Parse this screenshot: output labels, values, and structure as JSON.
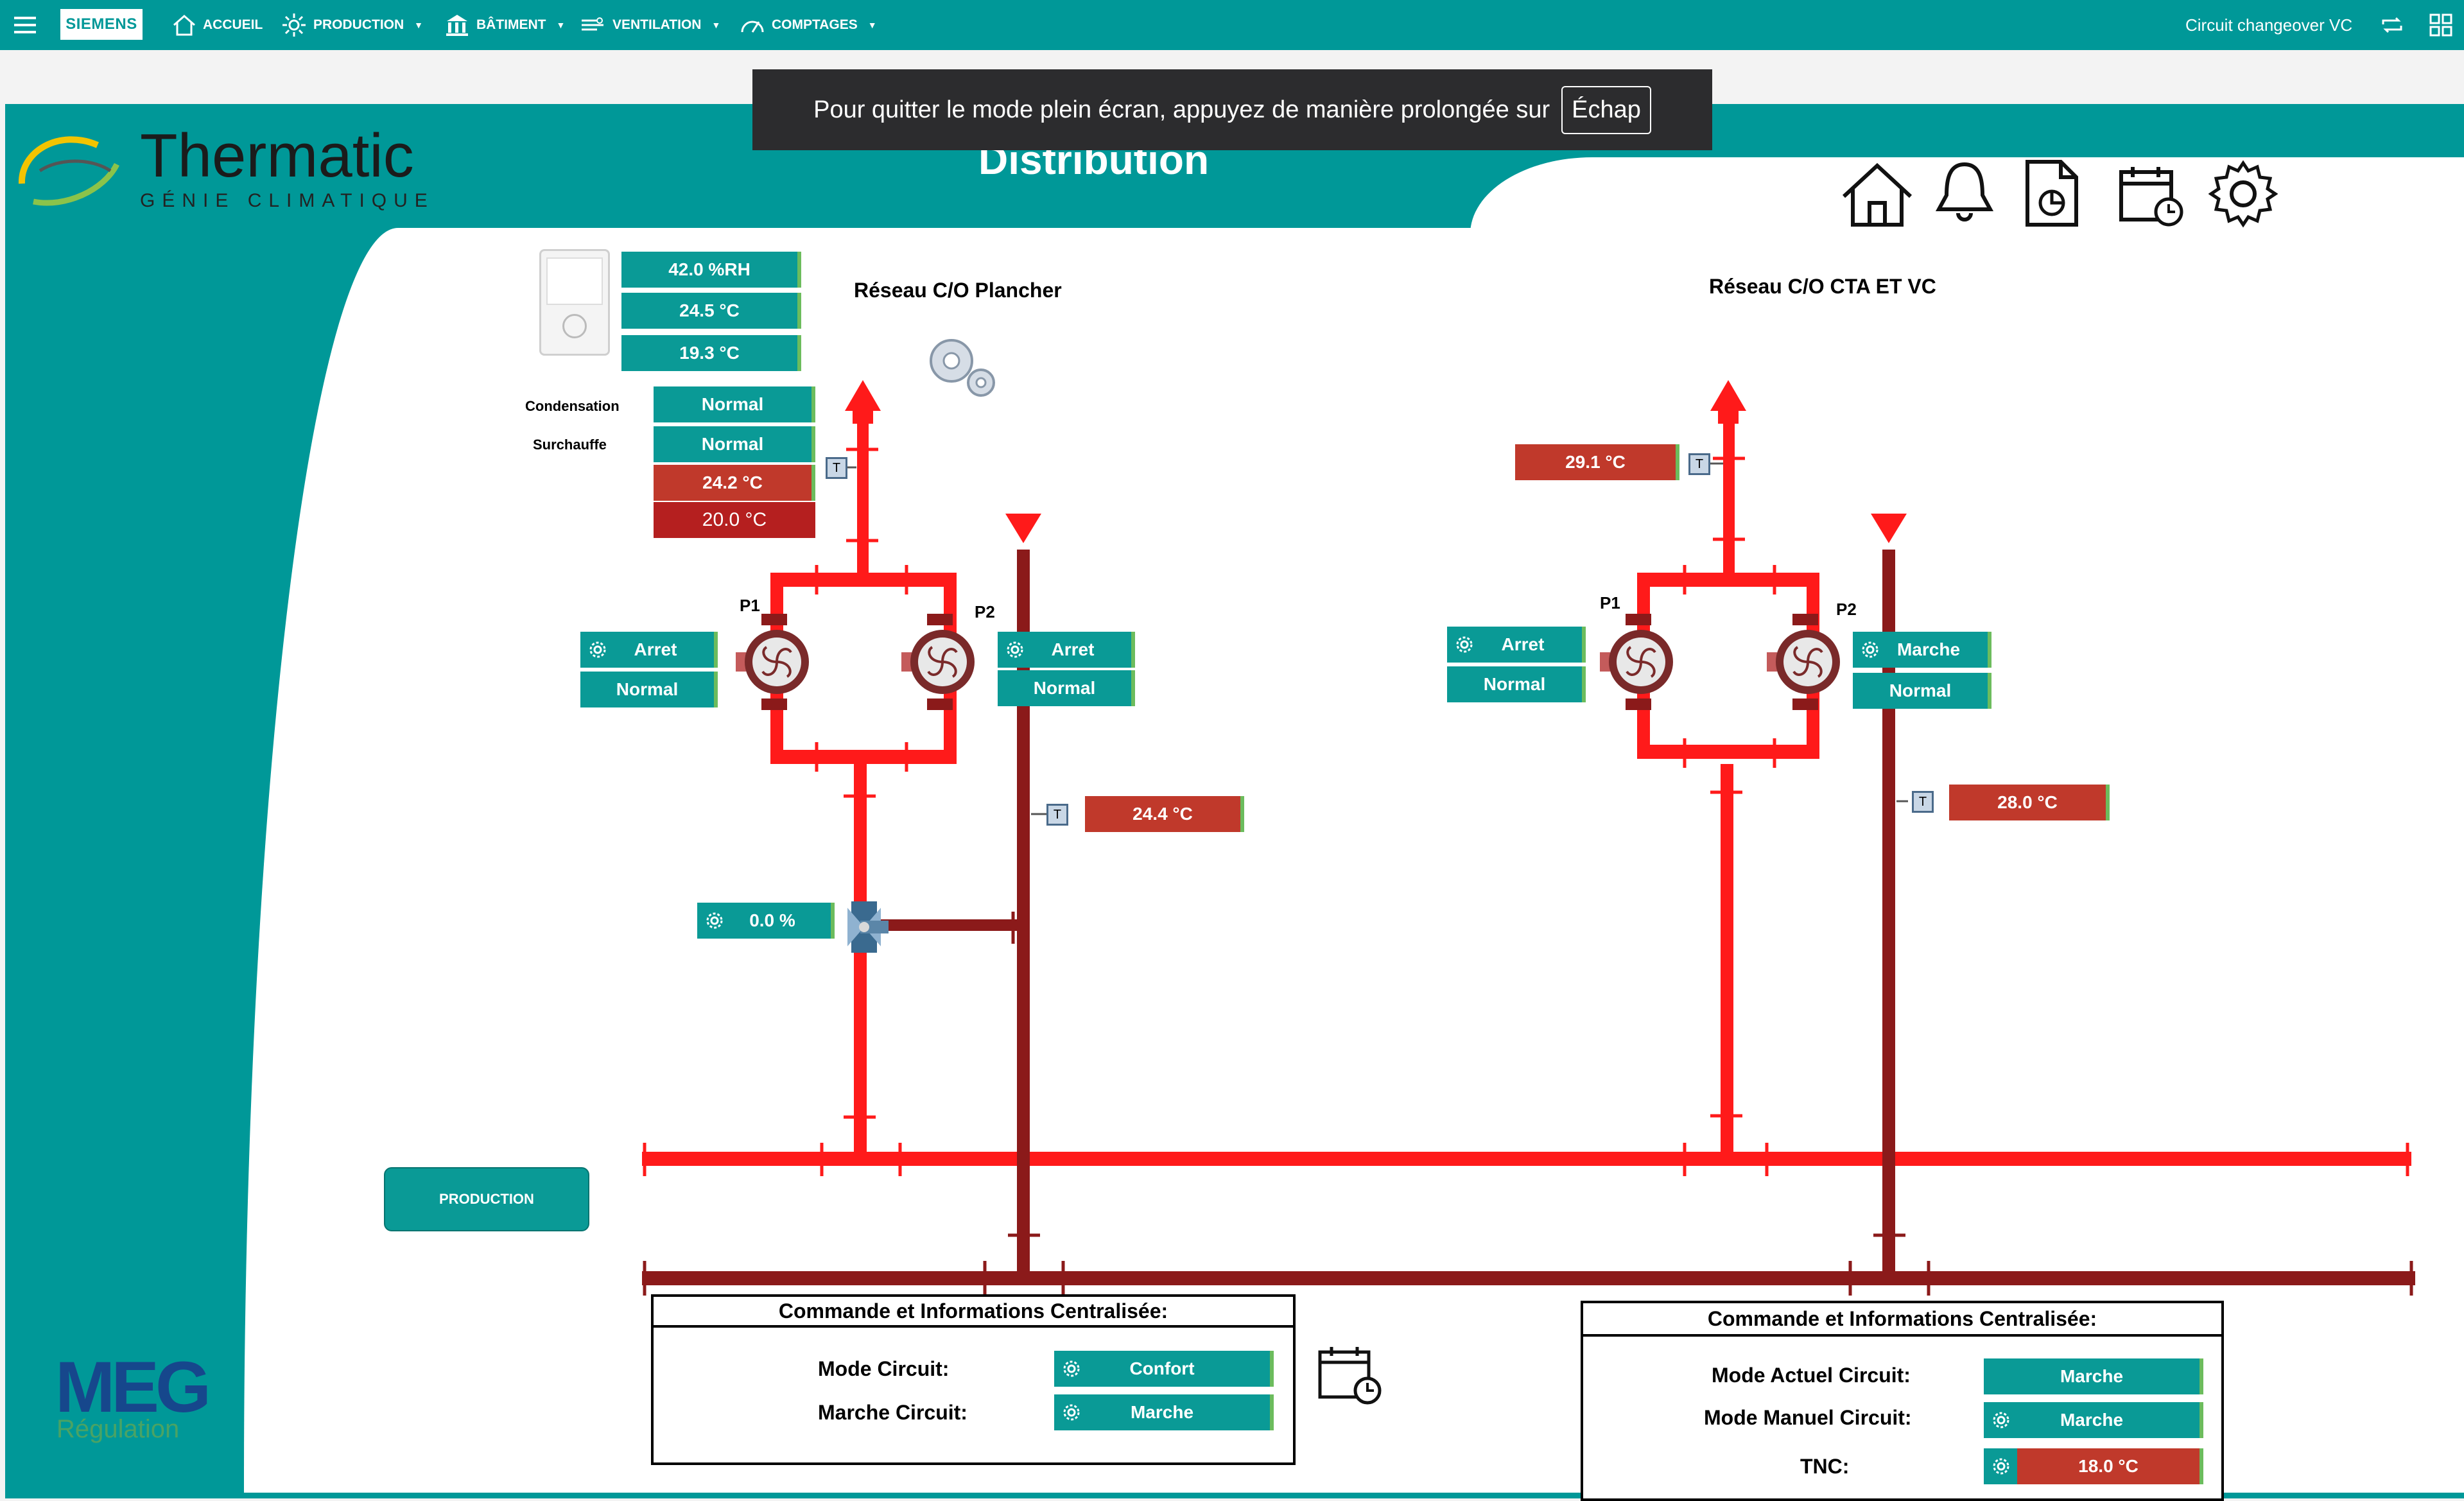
{
  "nav": {
    "brand": "SIEMENS",
    "home": "ACCUEIL",
    "production": "PRODUCTION",
    "batiment": "BÂTIMENT",
    "ventilation": "VENTILATION",
    "comptages": "COMPTAGES",
    "page_name": "Circuit changeover VC"
  },
  "fullscreen_notice": {
    "text": "Pour quitter le mode plein écran, appuyez de manière prolongée sur",
    "key": "Échap"
  },
  "logo": {
    "name": "Thermatic",
    "tagline": "GÉNIE CLIMATIQUE"
  },
  "page_title": "Distribution",
  "meg_logo": {
    "name": "MEG",
    "sub": "Régulation"
  },
  "left_circuit": {
    "title": "Réseau C/O Plancher",
    "ambient": {
      "humidity": "42.0 %RH",
      "temp1": "24.5 °C",
      "temp2": "19.3 °C"
    },
    "condensation_label": "Condensation",
    "condensation_value": "Normal",
    "surchauffe_label": "Surchauffe",
    "surchauffe_value": "Normal",
    "supply_temp": "24.2 °C",
    "setpoint_temp": "20.0 °C",
    "p1_label": "P1",
    "p1_state": "Arret",
    "p1_status": "Normal",
    "p2_label": "P2",
    "p2_state": "Arret",
    "p2_status": "Normal",
    "return_temp": "24.4 °C",
    "valve": "0.0 %",
    "sensor": "T"
  },
  "right_circuit": {
    "title": "Réseau C/O CTA ET VC",
    "supply_temp": "29.1 °C",
    "p1_label": "P1",
    "p1_state": "Arret",
    "p1_status": "Normal",
    "p2_label": "P2",
    "p2_state": "Marche",
    "p2_status": "Normal",
    "return_temp": "28.0 °C",
    "sensor": "T"
  },
  "production_button": "PRODUCTION",
  "left_command": {
    "title": "Commande et Informations Centralisée:",
    "mode_label": "Mode Circuit:",
    "mode_value": "Confort",
    "marche_label": "Marche Circuit:",
    "marche_value": "Marche"
  },
  "right_command": {
    "title": "Commande et Informations Centralisée:",
    "mode_actuel_label": "Mode Actuel Circuit:",
    "mode_actuel_value": "Marche",
    "mode_manuel_label": "Mode Manuel Circuit:",
    "mode_manuel_value": "Marche",
    "tnc_label": "TNC:",
    "tnc_value": "18.0 °C"
  },
  "colors": {
    "teal": "#009898",
    "supply_pipe": "#ff1a1a",
    "return_pipe": "#8b1a1a",
    "alarm": "#c0392b"
  }
}
